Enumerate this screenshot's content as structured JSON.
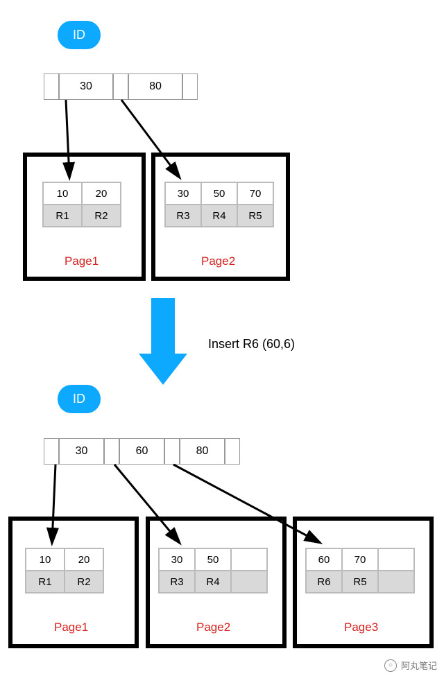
{
  "before": {
    "id_label": "ID",
    "root_keys": [
      "30",
      "80"
    ],
    "page1": {
      "keys": [
        "10",
        "20"
      ],
      "rows": [
        "R1",
        "R2"
      ],
      "label": "Page1"
    },
    "page2": {
      "keys": [
        "30",
        "50",
        "70"
      ],
      "rows": [
        "R3",
        "R4",
        "R5"
      ],
      "label": "Page2"
    }
  },
  "transition_label": "Insert R6 (60,6)",
  "after": {
    "id_label": "ID",
    "root_keys": [
      "30",
      "60",
      "80"
    ],
    "page1": {
      "keys": [
        "10",
        "20"
      ],
      "rows": [
        "R1",
        "R2"
      ],
      "label": "Page1"
    },
    "page2": {
      "keys": [
        "30",
        "50"
      ],
      "rows": [
        "R3",
        "R4"
      ],
      "label": "Page2"
    },
    "page3": {
      "keys": [
        "60",
        "70"
      ],
      "rows": [
        "R6",
        "R5"
      ],
      "label": "Page3"
    }
  },
  "watermark": "阿丸笔记"
}
